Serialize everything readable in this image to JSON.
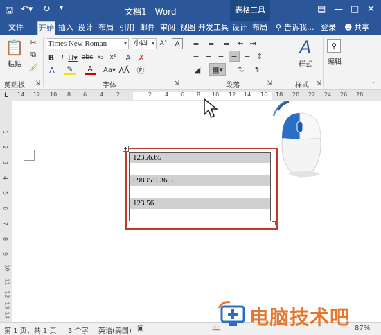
{
  "titlebar": {
    "title": "文档1 - Word",
    "context_tab": "表格工具",
    "qa_icons": [
      "save-icon",
      "undo-icon",
      "redo-icon",
      "customize-icon"
    ]
  },
  "tabs": [
    {
      "label": "文件"
    },
    {
      "label": "开始"
    },
    {
      "label": "插入"
    },
    {
      "label": "设计"
    },
    {
      "label": "布局"
    },
    {
      "label": "引用"
    },
    {
      "label": "邮件"
    },
    {
      "label": "审阅"
    },
    {
      "label": "视图"
    },
    {
      "label": "开发工具"
    },
    {
      "label": "设计"
    },
    {
      "label": "布局"
    }
  ],
  "tab_right": {
    "tell_me": "告诉我...",
    "login": "登录",
    "share": "共享"
  },
  "ribbon": {
    "paste_label": "粘贴",
    "font_name": "Times New Roman",
    "font_size": "小四",
    "styles_label": "样式",
    "edit_label": "编辑",
    "groups": {
      "clipboard": "剪贴板",
      "font": "字体",
      "paragraph": "段落",
      "styles": "样式"
    }
  },
  "ruler_numbers": [
    "14",
    "12",
    "10",
    "8",
    "6",
    "4",
    "2",
    "2",
    "4",
    "6",
    "8",
    "10",
    "12",
    "14",
    "16",
    "18",
    "20",
    "22",
    "24",
    "26",
    "28"
  ],
  "vruler_numbers": [
    "1",
    "2",
    "3",
    "4",
    "5",
    "6",
    "7",
    "8",
    "9",
    "10",
    "11",
    "12",
    "13",
    "14"
  ],
  "table": {
    "rows": [
      "12356.65",
      "598951536.5",
      "123.56"
    ]
  },
  "statusbar": {
    "page": "第 1 页，共 1 页",
    "words": "3 个字",
    "language": "英语(美国)",
    "zoom": "87%"
  },
  "watermark": {
    "text": "电脑技术吧"
  }
}
